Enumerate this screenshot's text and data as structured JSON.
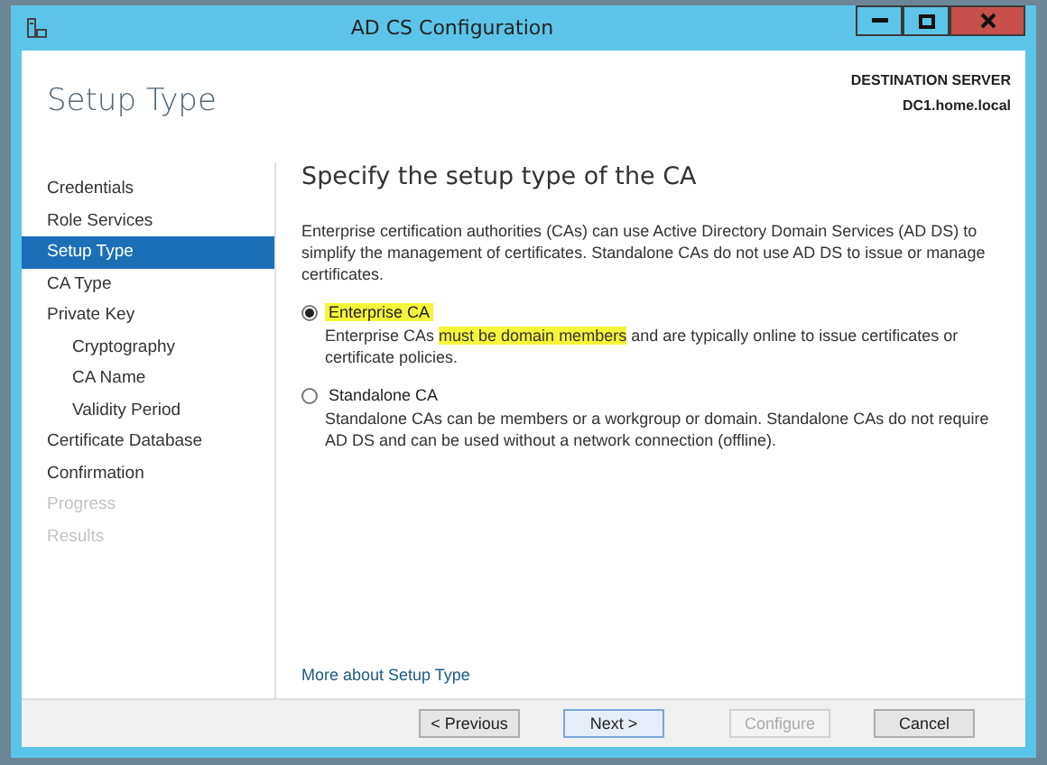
{
  "window": {
    "title": "AD CS Configuration"
  },
  "header": {
    "title": "Setup Type",
    "destination_label": "DESTINATION SERVER",
    "destination_server": "DC1.home.local"
  },
  "sidebar": {
    "items": [
      {
        "label": "Credentials",
        "selected": false,
        "disabled": false
      },
      {
        "label": "Role Services",
        "selected": false,
        "disabled": false
      },
      {
        "label": "Setup Type",
        "selected": true,
        "disabled": false
      },
      {
        "label": "CA Type",
        "selected": false,
        "disabled": false
      },
      {
        "label": "Private Key",
        "selected": false,
        "disabled": false,
        "children": [
          {
            "label": "Cryptography",
            "selected": false,
            "disabled": false
          },
          {
            "label": "CA Name",
            "selected": false,
            "disabled": false
          },
          {
            "label": "Validity Period",
            "selected": false,
            "disabled": false
          }
        ]
      },
      {
        "label": "Certificate Database",
        "selected": false,
        "disabled": false
      },
      {
        "label": "Confirmation",
        "selected": false,
        "disabled": false
      },
      {
        "label": "Progress",
        "selected": false,
        "disabled": true
      },
      {
        "label": "Results",
        "selected": false,
        "disabled": true
      }
    ]
  },
  "content": {
    "heading": "Specify the setup type of the CA",
    "intro": "Enterprise certification authorities (CAs) can use Active Directory Domain Services (AD DS) to simplify the management of certificates. Standalone CAs do not use AD DS to issue or manage certificates.",
    "options": [
      {
        "label": "Enterprise CA",
        "selected": true,
        "highlighted": true,
        "description": [
          {
            "text": "Enterprise CAs ",
            "highlighted": false
          },
          {
            "text": "must be domain members",
            "highlighted": true
          },
          {
            "text": " and are typically online to issue certificates or certificate policies.",
            "highlighted": false
          }
        ]
      },
      {
        "label": "Standalone CA",
        "selected": false,
        "highlighted": false,
        "description": [
          {
            "text": "Standalone CAs can be members or a workgroup or domain. Standalone CAs do not require AD DS and can be used without a network connection (offline).",
            "highlighted": false
          }
        ]
      }
    ],
    "link": "More about Setup Type"
  },
  "buttons": [
    {
      "label": "< Previous",
      "disabled": false,
      "default": false
    },
    {
      "label": "Next >",
      "disabled": false,
      "default": true
    },
    {
      "label": "Configure",
      "disabled": true,
      "default": false
    },
    {
      "label": "Cancel",
      "disabled": false,
      "default": false
    }
  ]
}
